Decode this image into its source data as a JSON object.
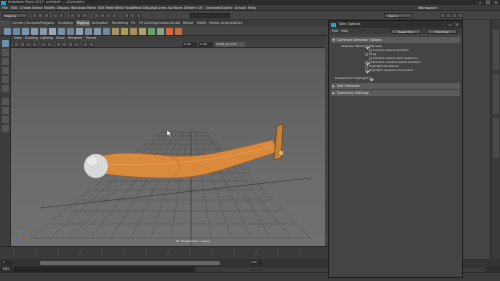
{
  "window": {
    "title": "Autodesk Maya 2017: untitled* --- pCylinder1"
  },
  "menubar": {
    "items": [
      "File",
      "Edit",
      "Create",
      "Select",
      "Modify",
      "Display",
      "Windows",
      "Mesh",
      "Edit Mesh",
      "Mesh Tools",
      "Mesh Display",
      "Curves",
      "Surfaces",
      "Deform",
      "UV",
      "Generate",
      "Cache",
      "Arnold",
      "Help"
    ]
  },
  "statusline": {
    "mode": "Rigging",
    "signin": "Sign In",
    "workspace": "Workspace :"
  },
  "shelf": {
    "tabs": [
      "Curves / Surfaces",
      "Polygons",
      "Sculpting",
      "Rigging",
      "Animation",
      "Rendering",
      "FX",
      "FX Caching",
      "Custom",
      "Arnold",
      "Bifrost",
      "MASH",
      "Motion Graphics",
      "XGen"
    ],
    "active_tab": "Rigging"
  },
  "panel": {
    "menu": [
      "View",
      "Shading",
      "Lighting",
      "Show",
      "Renderer",
      "Panels"
    ],
    "gamma": "0.00",
    "exposure": "1.00",
    "colorspace": "sRGB gamma",
    "camera_label": "persp"
  },
  "viewport": {
    "label": "ID: Perspective : persp"
  },
  "dialog": {
    "title": "Skin Options",
    "menu": [
      "Edit",
      "Help"
    ],
    "reset_button": "Reset Tool",
    "help_button": "Tool Help",
    "section_common": "Common Selection Options",
    "selection_mode_label": "Selection Mode:",
    "options": [
      {
        "label": "Marquee",
        "checked": true
      },
      {
        "label": "Camera based selection",
        "checked": false
      },
      {
        "label": "Drag",
        "checked": false
      },
      {
        "label": "Camera based paint selection",
        "checked": false
      },
      {
        "label": "Automatic camera based selection",
        "checked": true
      },
      {
        "label": "Highlight backfaces",
        "checked": false
      },
      {
        "label": "Highlight nearest component",
        "checked": true
      }
    ],
    "preselection_label": "Preselection Highlight:",
    "section_soft": "Soft Selection",
    "section_symmetry": "Symmetry Settings"
  },
  "timeline": {
    "start": "1",
    "end": "120"
  },
  "cmdline": {
    "lang": "MEL"
  },
  "colors": {
    "accent": "#1aa7c8",
    "arm": "#d98a3c",
    "arm_dark": "#a85e1e",
    "ball": "#d8d8d8",
    "panel_bg": "#444444"
  }
}
